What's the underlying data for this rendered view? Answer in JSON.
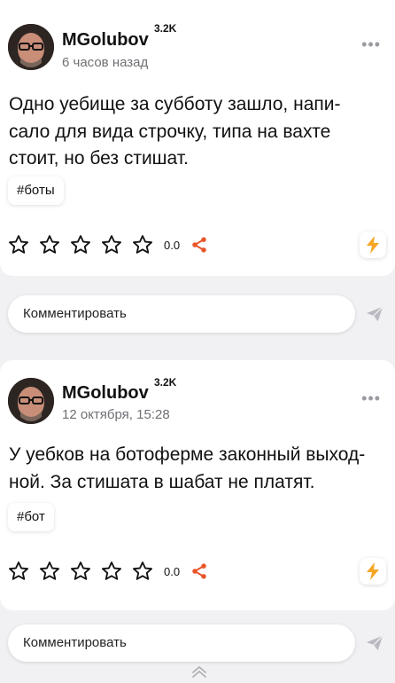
{
  "posts": [
    {
      "author": "MGolubov",
      "karma": "3.2K",
      "time": "6 часов назад",
      "text": "Одно уебище за субботу зашло, напи-сало для вида строчку, типа на вахте стоит, но без стишат.",
      "tag": "#боты",
      "rating": "0.0",
      "comment_placeholder": "Комментировать"
    },
    {
      "author": "MGolubov",
      "karma": "3.2K",
      "time": "12 октября, 15:28",
      "text": "У уебков на ботоферме законный выход-ной. За стишата в шабат не платят.",
      "tag": "#бот",
      "rating": "0.0",
      "comment_placeholder": "Комментировать"
    }
  ],
  "icons": {
    "more": "more-dots-icon",
    "star": "star-outline-icon",
    "share": "share-icon",
    "bolt": "lightning-icon",
    "send": "send-icon",
    "scroll_up": "chevron-up-icon"
  },
  "colors": {
    "accent": "#f5a623",
    "share": "#e8552a",
    "background": "#f1f1f4"
  }
}
